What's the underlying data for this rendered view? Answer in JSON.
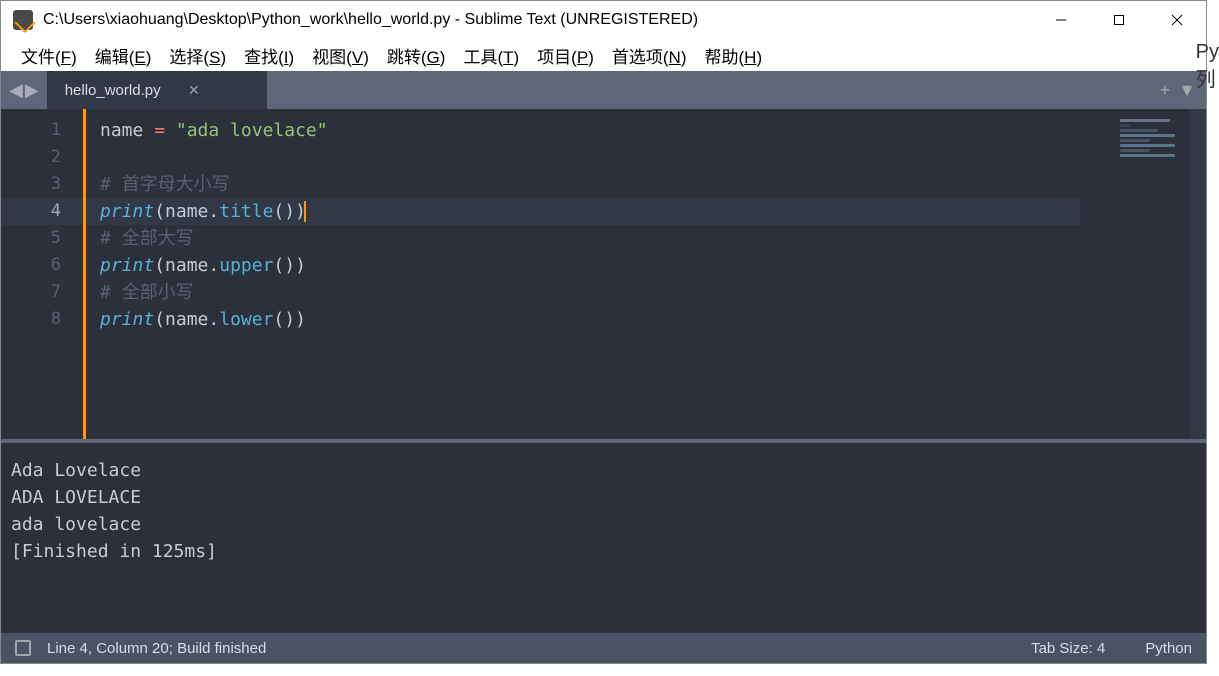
{
  "titlebar": {
    "text": "C:\\Users\\xiaohuang\\Desktop\\Python_work\\hello_world.py - Sublime Text (UNREGISTERED)"
  },
  "menus": {
    "file": "文件(<u>F</u>)",
    "edit": "编辑(<u>E</u>)",
    "select": "选择(<u>S</u>)",
    "find": "查找(<u>I</u>)",
    "view": "视图(<u>V</u>)",
    "goto": "跳转(<u>G</u>)",
    "tools": "工具(<u>T</u>)",
    "project": "项目(<u>P</u>)",
    "prefs": "首选项(<u>N</u>)",
    "help": "帮助(<u>H</u>)"
  },
  "tab": {
    "title": "hello_world.py",
    "close": "×"
  },
  "code": {
    "active_line": 4,
    "lines": [
      "1",
      "2",
      "3",
      "4",
      "5",
      "6",
      "7",
      "8"
    ],
    "l1_var": "name",
    "l1_op": " = ",
    "l1_str": "\"ada lovelace\"",
    "l3_cmt": "# 首字母大小写",
    "l4_fn": "print",
    "l4_open": "(",
    "l4_var": "name",
    "l4_dot": ".",
    "l4_method": "title",
    "l4_call": "()",
    "l4_close": ")",
    "l5_cmt": "# 全部大写",
    "l6_fn": "print",
    "l6_open": "(",
    "l6_var": "name",
    "l6_dot": ".",
    "l6_method": "upper",
    "l6_call": "()",
    "l6_close": ")",
    "l7_cmt": "# 全部小写",
    "l8_fn": "print",
    "l8_open": "(",
    "l8_var": "name",
    "l8_dot": ".",
    "l8_method": "lower",
    "l8_call": "()",
    "l8_close": ")"
  },
  "output": {
    "l1": "Ada Lovelace",
    "l2": "ADA LOVELACE",
    "l3": "ada lovelace",
    "l4": "[Finished in 125ms]"
  },
  "status": {
    "left": "Line 4, Column 20; Build finished",
    "tabsize": "Tab Size: 4",
    "lang": "Python"
  },
  "icons": {
    "nav_back": "◀",
    "nav_fwd": "▶",
    "plus": "+",
    "dropdown": "▼"
  },
  "side_clip": "Py\n列"
}
